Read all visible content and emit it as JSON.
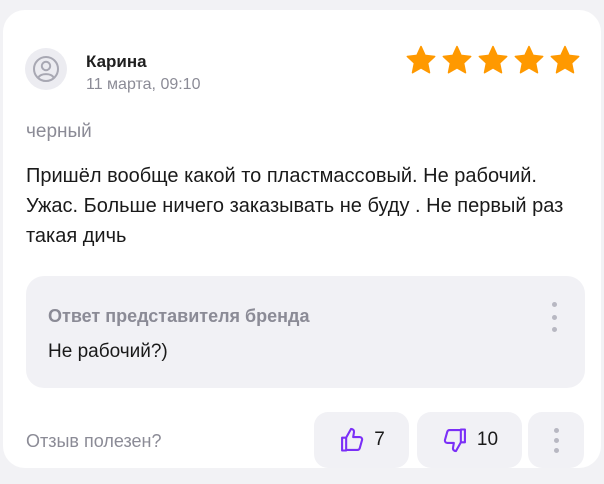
{
  "review": {
    "author_name": "Карина",
    "date": "11 марта, 09:10",
    "rating": 5,
    "variant": "черный",
    "text": "Пришёл вообще какой то пластмассовый. Не рабочий. Ужас. Больше ничего заказывать не буду . Не первый раз такая дичь"
  },
  "brand_reply": {
    "title": "Ответ представителя бренда",
    "text": "Не рабочий?)"
  },
  "feedback": {
    "label": "Отзыв полезен?",
    "likes": "7",
    "dislikes": "10"
  },
  "colors": {
    "star": "#ff9900",
    "vote_icon": "#7b2ff7",
    "muted_text": "#8b8b96"
  },
  "icons": {
    "avatar": "user-avatar-icon",
    "star": "star-icon",
    "like": "thumbs-up-icon",
    "dislike": "thumbs-down-icon",
    "menu": "more-vertical-icon"
  }
}
